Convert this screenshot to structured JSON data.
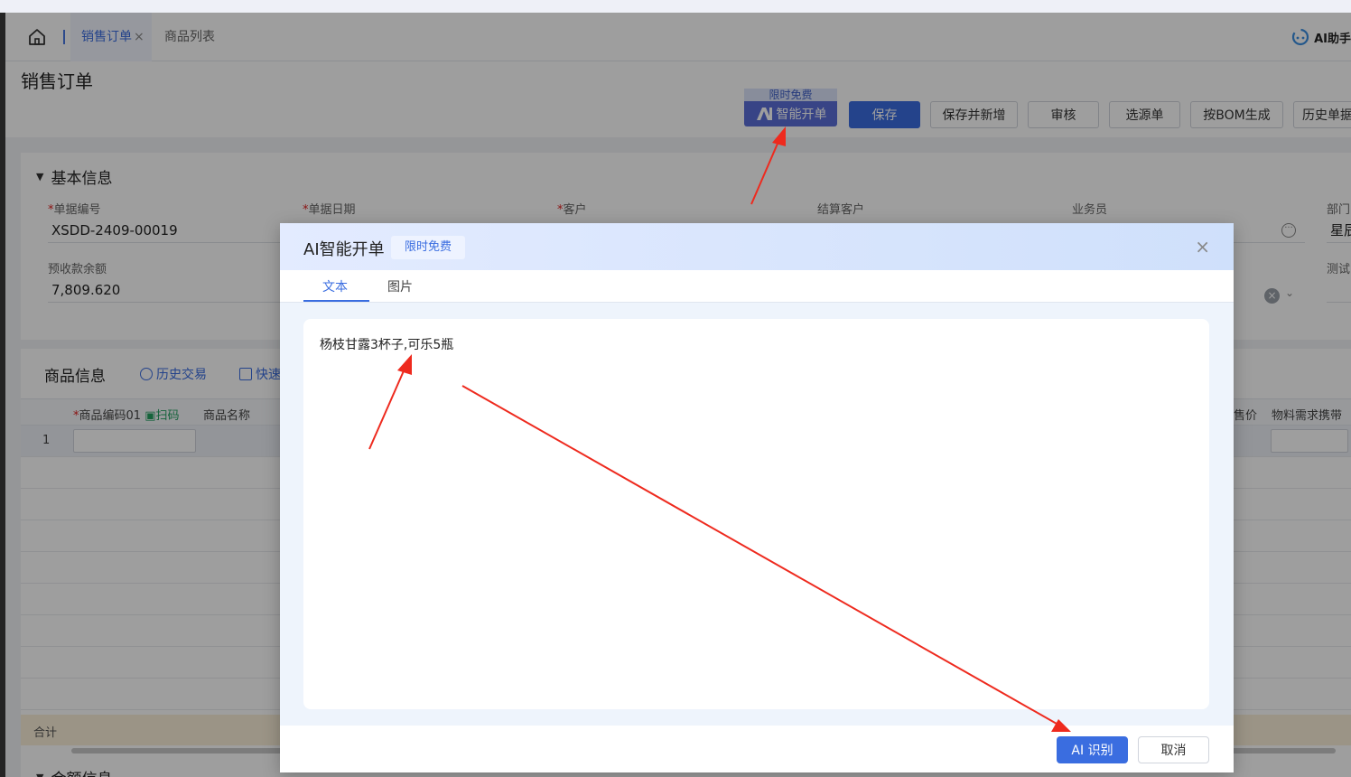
{
  "tabs": {
    "active_label": "销售订单",
    "close_glyph": "×",
    "inactive_label": "商品列表",
    "ai_helper_label": "AI助手"
  },
  "page": {
    "title": "销售订单"
  },
  "toolbar": {
    "ai_tag": "限时免费",
    "ai_button_label": "智能开单",
    "save": "保存",
    "save_new": "保存并新增",
    "audit": "审核",
    "select_source": "选源单",
    "bom_generate": "按BOM生成",
    "history": "历史单据"
  },
  "basic_info": {
    "title": "基本信息",
    "fields": [
      {
        "label": "单据编号",
        "required": true,
        "value": "XSDD-2409-00019"
      },
      {
        "label": "单据日期",
        "required": true,
        "value": ""
      },
      {
        "label": "客户",
        "required": true,
        "value": ""
      },
      {
        "label": "结算客户",
        "required": false,
        "value": ""
      },
      {
        "label": "业务员",
        "required": false,
        "value": ""
      },
      {
        "label": "部门",
        "required": false,
        "value": "星辰"
      },
      {
        "label": "预收款余额",
        "required": false,
        "value": "7,809.620"
      },
      {
        "label": "测试",
        "required": false,
        "value": ""
      }
    ]
  },
  "goods": {
    "title": "商品信息",
    "history_link": "历史交易",
    "quick_link": "快速",
    "columns": [
      "商品编码01",
      "扫码",
      "商品名称",
      "售价",
      "物料需求携带"
    ],
    "first_row_num": "1",
    "sum_label": "合计"
  },
  "amount_section": {
    "title": "金额信息"
  },
  "dialog": {
    "title": "AI智能开单",
    "badge": "限时免费",
    "close_glyph": "×",
    "tabs": [
      "文本",
      "图片"
    ],
    "text_value": "杨枝甘露3杯子,可乐5瓶",
    "recognize_button": "AI 识别",
    "cancel_button": "取消"
  },
  "colors": {
    "primary": "#3a6de0",
    "annotation_arrow": "#ee2a1e",
    "required_mark": "#e02020"
  }
}
